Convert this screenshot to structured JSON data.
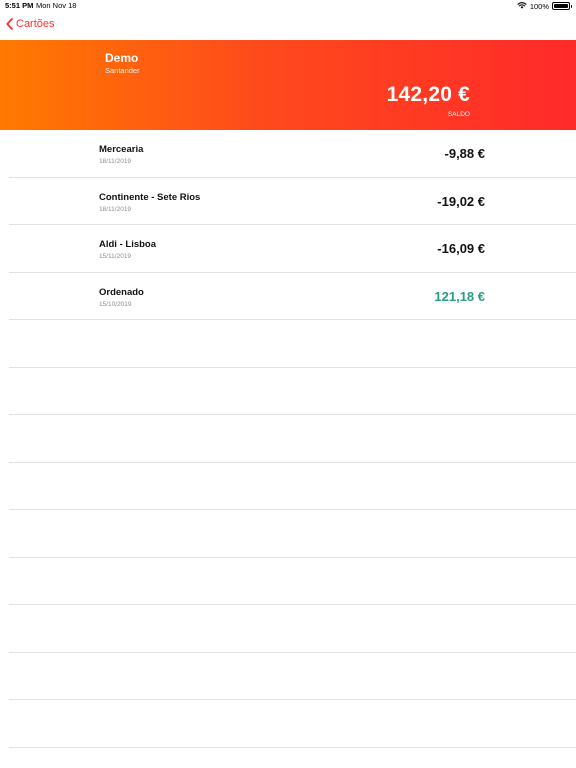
{
  "status_bar": {
    "time": "5:51 PM",
    "date": "Mon Nov 18",
    "battery_text": "100%",
    "battery_level": 1.0
  },
  "nav": {
    "back_label": "Cartões"
  },
  "account": {
    "name": "Demo",
    "bank": "Santander",
    "balance": "142,20 €",
    "balance_label": "SALDO",
    "gradient_start": "#ff7a00",
    "gradient_end": "#ff2a2a"
  },
  "colors": {
    "accent": "#ff3030",
    "positive": "#2a9d86"
  },
  "transactions": [
    {
      "title": "Mercearia",
      "date": "18/11/2019",
      "amount": "-9,88 €",
      "positive": false
    },
    {
      "title": "Continente - Sete Rios",
      "date": "18/11/2019",
      "amount": "-19,02 €",
      "positive": false
    },
    {
      "title": "Aldi - Lisboa",
      "date": "15/11/2019",
      "amount": "-16,09 €",
      "positive": false
    },
    {
      "title": "Ordenado",
      "date": "15/10/2019",
      "amount": "121,18 €",
      "positive": true
    }
  ],
  "empty_rows": 9
}
